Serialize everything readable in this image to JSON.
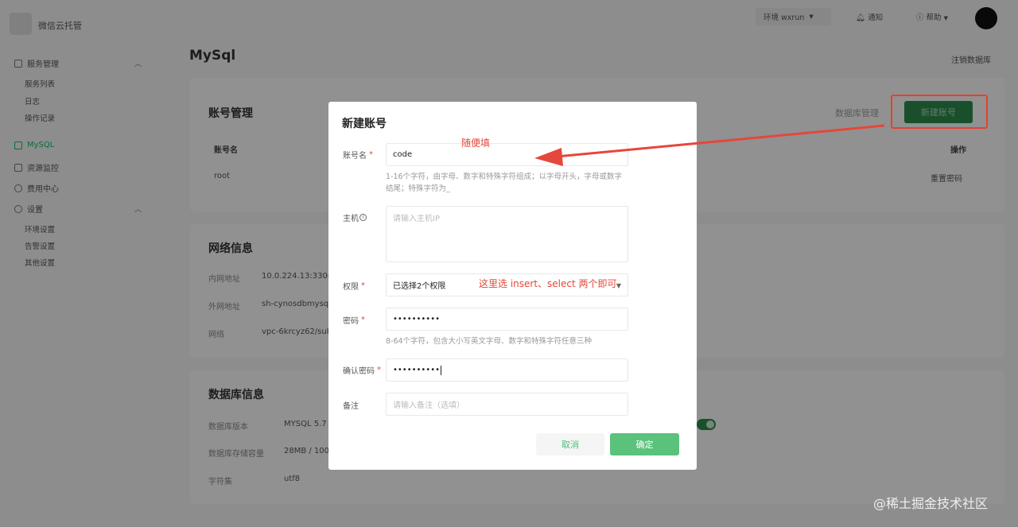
{
  "app": {
    "title": "微信云托管"
  },
  "sidebar": {
    "service_group": "服务管理",
    "service_items": [
      "服务列表",
      "日志",
      "操作记录"
    ],
    "mysql": "MySQL",
    "monitor": "资源监控",
    "billing": "费用中心",
    "settings_group": "设置",
    "settings_items": [
      "环境设置",
      "告警设置",
      "其他设置"
    ]
  },
  "topbar": {
    "env": "环境 wxrun",
    "notify": "通知",
    "help": "帮助"
  },
  "page": {
    "title": "MySql",
    "logout": "注销数据库"
  },
  "account_card": {
    "title": "账号管理",
    "manage_db": "数据库管理",
    "new_account": "新建账号",
    "col_name": "账号名",
    "col_action": "操作",
    "row_name": "root",
    "row_action": "重置密码"
  },
  "network_card": {
    "title": "网络信息",
    "labels": [
      "内网地址",
      "外网地址",
      "网络"
    ],
    "values": [
      "10.0.224.13:3306",
      "sh-cynosdbmysql",
      "vpc-6krcyz62/sub"
    ]
  },
  "db_card": {
    "title": "数据库信息",
    "labels": [
      "数据库版本",
      "数据库存储容量",
      "字符集"
    ],
    "values": [
      "MYSQL 5.7",
      "28MB / 100",
      "utf8"
    ]
  },
  "modal": {
    "title": "新建账号",
    "account_label": "账号名",
    "account_value": "code",
    "account_hint": "1-16个字符，由字母、数字和特殊字符组成；以字母开头，字母或数字结尾；特殊字符为_",
    "host_label": "主机",
    "host_placeholder": "请输入主机IP",
    "perm_label": "权限",
    "perm_value": "已选择2个权限",
    "password_label": "密码",
    "password_value": "••••••••••",
    "password_hint": "8-64个字符，包含大小写英文字母、数字和特殊字符任意三种",
    "confirm_label": "确认密码",
    "confirm_value": "••••••••••",
    "remark_label": "备注",
    "remark_placeholder": "请输入备注（选填）",
    "cancel": "取消",
    "ok": "确定"
  },
  "annotations": {
    "fill_any": "随便填",
    "select_hint": "这里选 insert、select 两个即可"
  },
  "watermark": "@稀土掘金技术社区",
  "colors": {
    "accent": "#07c160",
    "annotation": "#e5473a"
  }
}
